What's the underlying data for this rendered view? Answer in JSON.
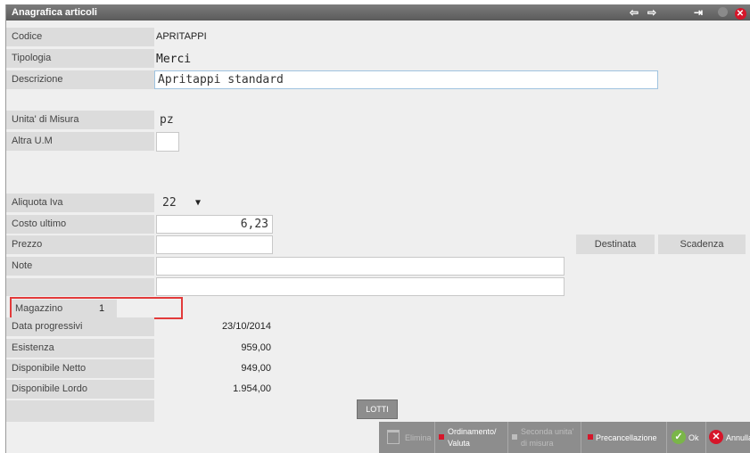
{
  "window": {
    "title": "Anagrafica articoli"
  },
  "fields": {
    "codice": {
      "label": "Codice",
      "value": "APRITAPPI"
    },
    "tipologia": {
      "label": "Tipologia",
      "value": "Merci"
    },
    "descrizione": {
      "label": "Descrizione",
      "value": "Apritappi standard"
    },
    "unita_misura": {
      "label": "Unita' di Misura",
      "value": "pz"
    },
    "altra_um": {
      "label": "Altra U.M",
      "value": ""
    },
    "aliquota_iva": {
      "label": "Aliquota Iva",
      "value": "22"
    },
    "costo_ultimo": {
      "label": "Costo ultimo",
      "value": "6,23"
    },
    "prezzo": {
      "label": "Prezzo",
      "value": ""
    },
    "note": {
      "label": "Note",
      "value": "",
      "value2": ""
    }
  },
  "magazzino": {
    "label": "Magazzino",
    "value": "1"
  },
  "progressivi": {
    "data": {
      "label": "Data progressivi",
      "value": "23/10/2014"
    },
    "esistenza": {
      "label": "Esistenza",
      "value": "959,00"
    },
    "disp_netto": {
      "label": "Disponibile Netto",
      "value": "949,00"
    },
    "disp_lordo": {
      "label": "Disponibile Lordo",
      "value": "1.954,00"
    }
  },
  "buttons": {
    "destinata": "Destinata",
    "scadenza": "Scadenza",
    "lotti": "LOTTI"
  },
  "bottombar": {
    "elimina": "Elimina",
    "ordinamento_1": "Ordinamento/",
    "ordinamento_2": "Valuta",
    "seconda_1": "Seconda unita'",
    "seconda_2": "di misura",
    "precancellazione": "Precancellazione",
    "ok": "Ok",
    "annulla": "Annulla"
  },
  "colors": {
    "titlebar": "#5a5a5a",
    "label_bg": "#dcdcdc",
    "highlight_box": "#e23a3a",
    "action_red": "#d6162a",
    "ok_green": "#7ab648"
  }
}
